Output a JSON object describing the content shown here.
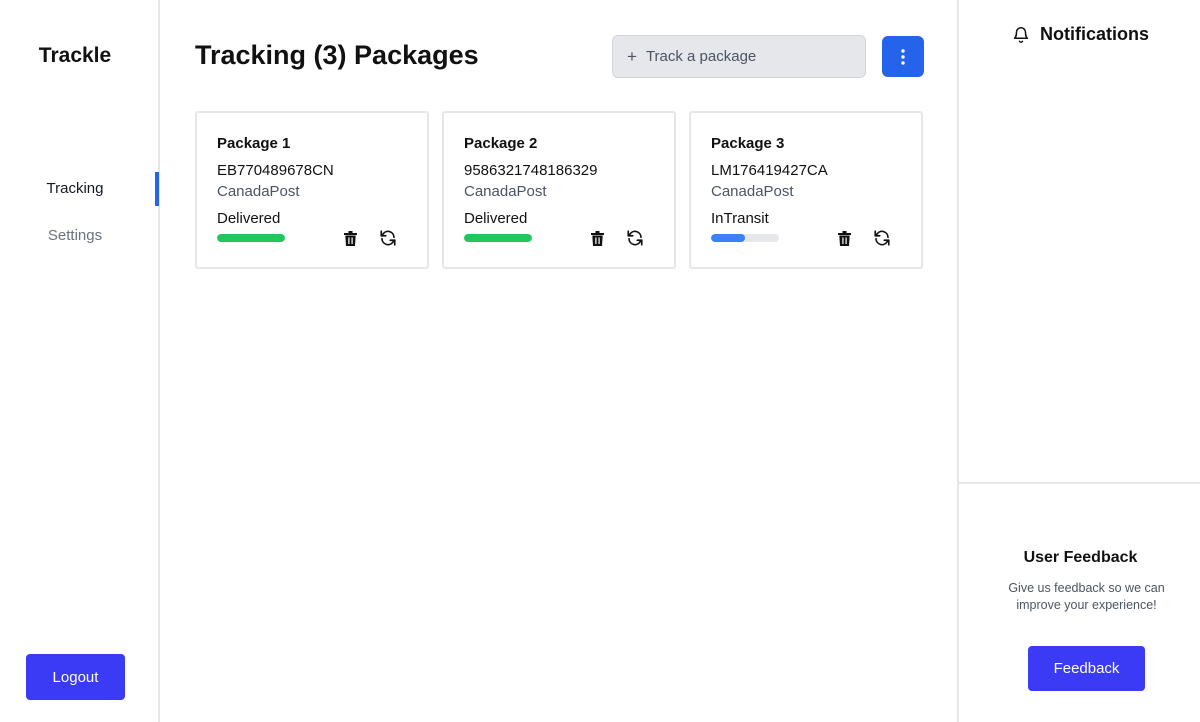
{
  "sidebar": {
    "brand": "Trackle",
    "nav": [
      {
        "label": "Tracking",
        "active": true
      },
      {
        "label": "Settings",
        "active": false
      }
    ],
    "logout_label": "Logout"
  },
  "header": {
    "title": "Tracking (3) Packages",
    "track_placeholder": "Track a package",
    "plus_icon": "plus-icon",
    "menu_icon": "vertical-dots-icon"
  },
  "packages": [
    {
      "name": "Package 1",
      "code": "EB770489678CN",
      "carrier": "CanadaPost",
      "status": "Delivered",
      "progress": 1.0,
      "color": "#22c55e"
    },
    {
      "name": "Package 2",
      "code": "9586321748186329",
      "carrier": "CanadaPost",
      "status": "Delivered",
      "progress": 1.0,
      "color": "#22c55e"
    },
    {
      "name": "Package 3",
      "code": "LM176419427CA",
      "carrier": "CanadaPost",
      "status": "InTransit",
      "progress": 0.5,
      "color": "#3b82f6"
    }
  ],
  "notifications": {
    "title": "Notifications",
    "icon": "bell-icon"
  },
  "feedback": {
    "title": "User Feedback",
    "description": "Give us feedback so we can improve your experience!",
    "button_label": "Feedback"
  },
  "colors": {
    "accent_blue": "#2563eb",
    "button_indigo": "#3b3bf5",
    "delivered_green": "#22c55e",
    "transit_blue": "#3b82f6"
  }
}
